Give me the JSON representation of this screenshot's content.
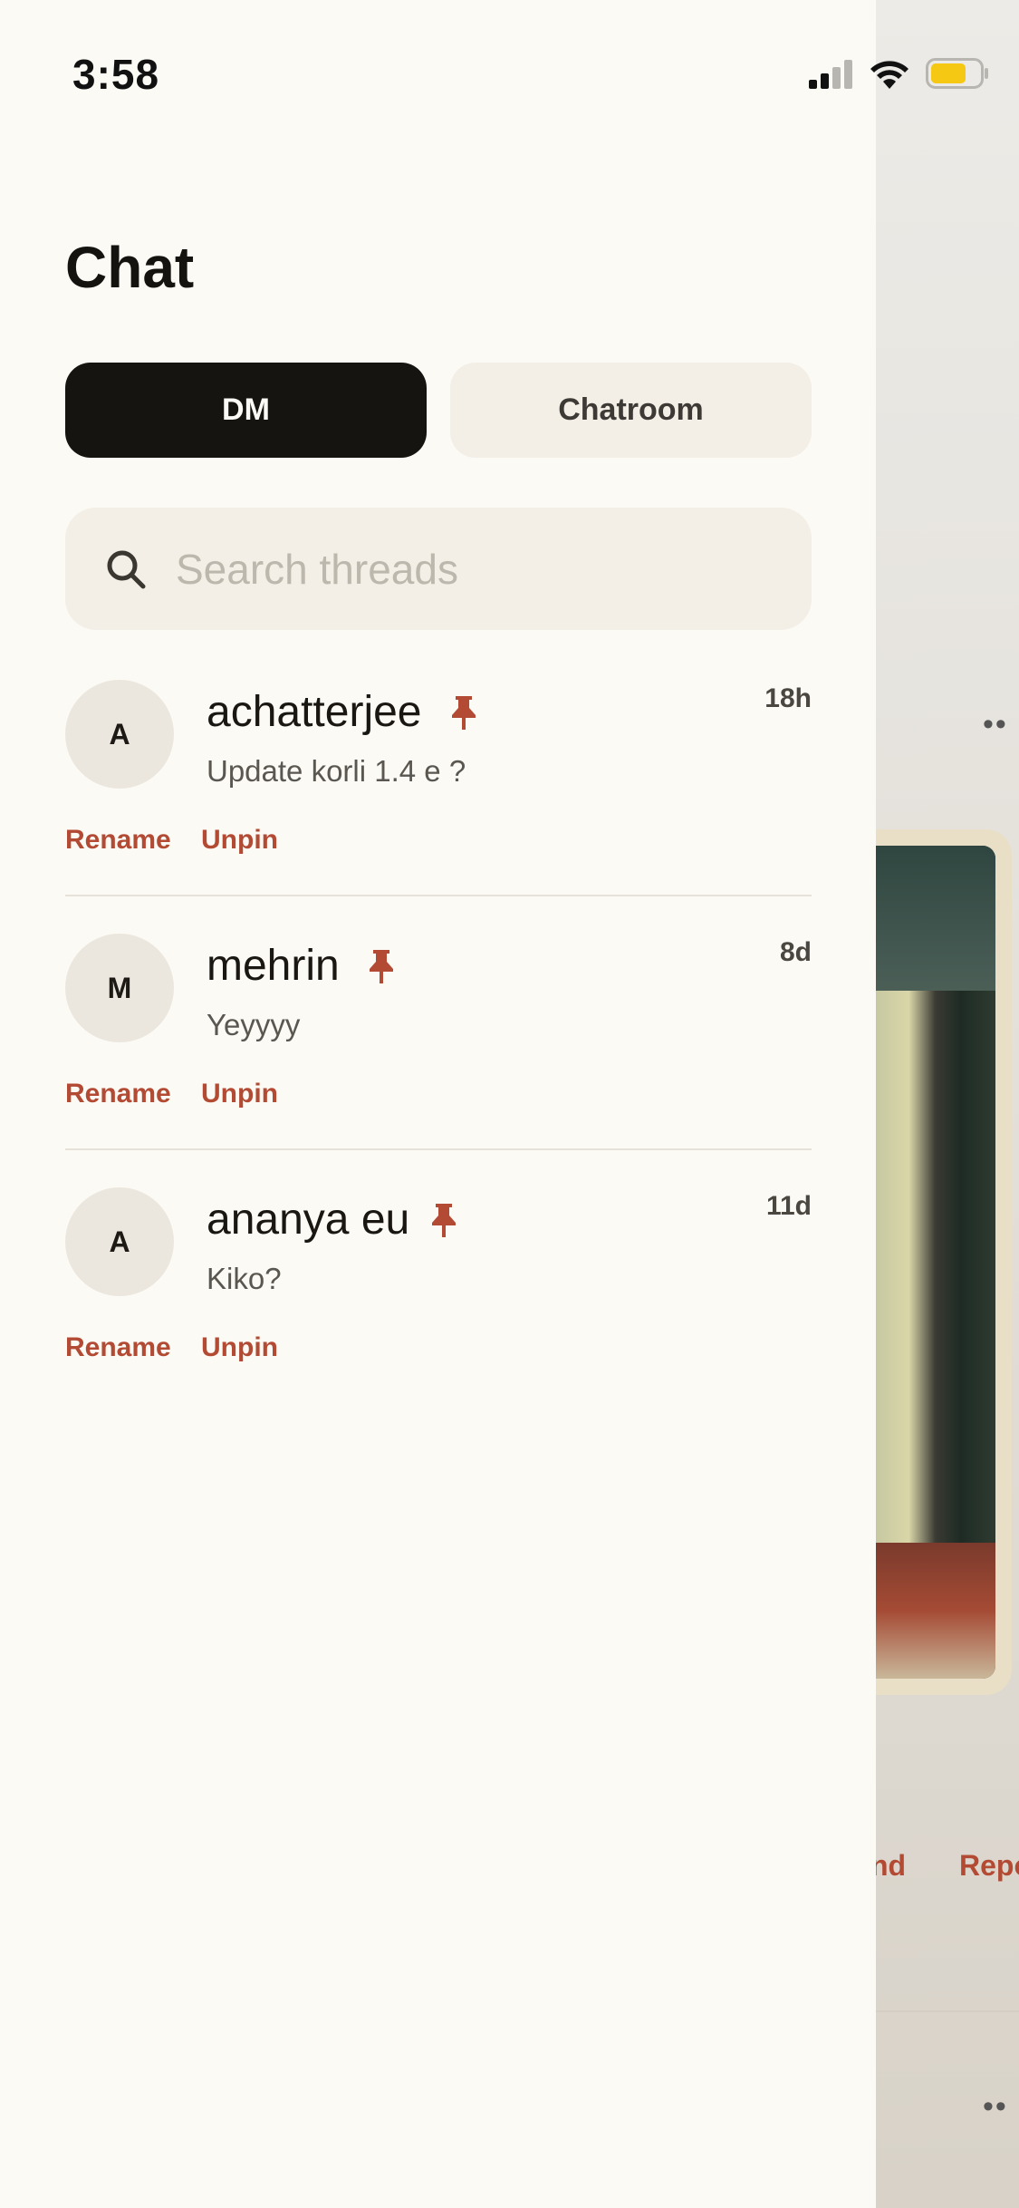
{
  "status_bar": {
    "time": "3:58"
  },
  "header": {
    "title": "Chat"
  },
  "tabs": {
    "dm_label": "DM",
    "chatroom_label": "Chatroom"
  },
  "search": {
    "placeholder": "Search threads"
  },
  "threads": [
    {
      "initial": "A",
      "name": "achatterjee",
      "time": "18h",
      "preview": "Update korli 1.4 e ?",
      "rename_label": "Rename",
      "unpin_label": "Unpin"
    },
    {
      "initial": "M",
      "name": "mehrin",
      "time": "8d",
      "preview": "Yeyyyy",
      "rename_label": "Rename",
      "unpin_label": "Unpin"
    },
    {
      "initial": "A",
      "name": "ananya eu",
      "time": "11d",
      "preview": "Kiko?",
      "rename_label": "Rename",
      "unpin_label": "Unpin"
    }
  ],
  "background": {
    "action_1": "nd",
    "action_2": "Repo",
    "more_1": "••",
    "more_2": "••"
  },
  "colors": {
    "accent": "#b34a34",
    "selected_tab": "#161410",
    "panel": "#fbfaf4"
  },
  "icons": {
    "search": "search-icon",
    "pin": "pin-icon",
    "signal": "cellular-signal-icon",
    "wifi": "wifi-icon",
    "battery": "battery-icon"
  }
}
